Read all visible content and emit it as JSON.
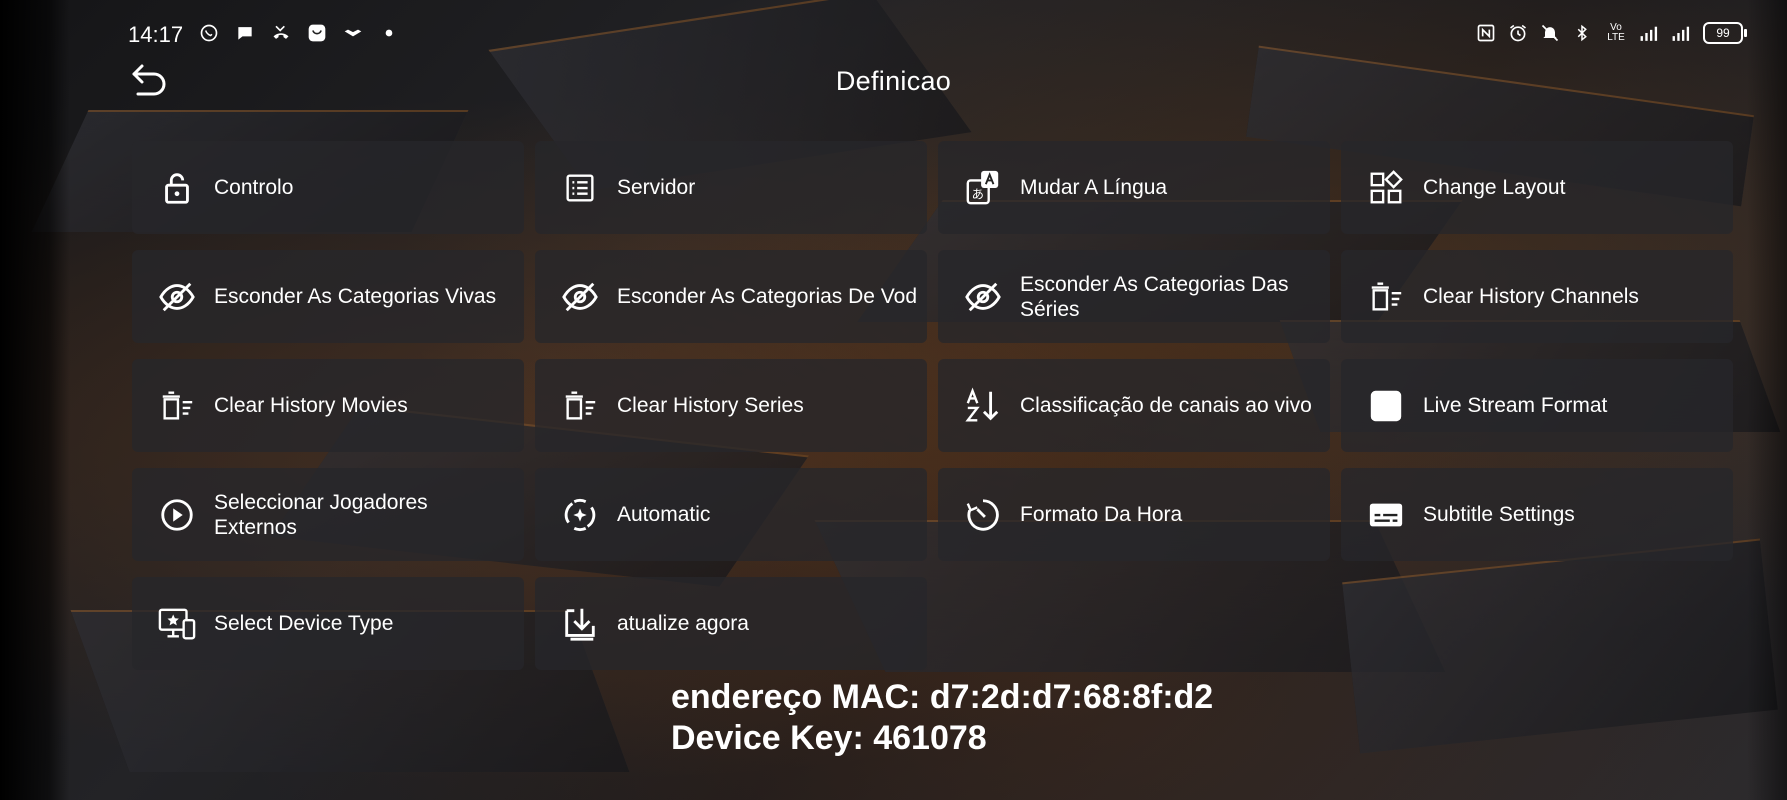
{
  "status_bar": {
    "time": "14:17",
    "battery": "99",
    "left_icons": [
      "whatsapp-icon",
      "chat-icon",
      "missed-call-icon",
      "app-icon",
      "bird-icon",
      "dot-icon"
    ],
    "right_icons": [
      "nfc-icon",
      "alarm-icon",
      "mute-icon",
      "bluetooth-icon",
      "volte-icon",
      "signal-4g-icon",
      "signal-icon"
    ]
  },
  "header": {
    "title": "Definicao"
  },
  "tiles": [
    {
      "label": "Controlo",
      "icon": "lock-icon"
    },
    {
      "label": "Servidor",
      "icon": "list-icon"
    },
    {
      "label": "Mudar A Língua",
      "icon": "translate-icon"
    },
    {
      "label": "Change Layout",
      "icon": "layout-icon"
    },
    {
      "label": "Esconder As Categorias Vivas",
      "icon": "eye-off-icon"
    },
    {
      "label": "Esconder As Categorias De Vod",
      "icon": "eye-off-icon"
    },
    {
      "label": "Esconder As Categorias Das Séries",
      "icon": "eye-off-icon"
    },
    {
      "label": "Clear History Channels",
      "icon": "delete-sweep-icon"
    },
    {
      "label": "Clear History Movies",
      "icon": "delete-sweep-icon"
    },
    {
      "label": "Clear History Series",
      "icon": "delete-sweep-icon"
    },
    {
      "label": "Classificação de canais ao vivo",
      "icon": "sort-az-icon"
    },
    {
      "label": "Live Stream Format",
      "icon": "square-icon"
    },
    {
      "label": "Seleccionar Jogadores Externos",
      "icon": "play-circle-icon"
    },
    {
      "label": "Automatic",
      "icon": "auto-icon"
    },
    {
      "label": "Formato Da Hora",
      "icon": "clock-icon"
    },
    {
      "label": "Subtitle Settings",
      "icon": "subtitles-icon"
    },
    {
      "label": "Select Device Type",
      "icon": "device-icon"
    },
    {
      "label": "atualize agora",
      "icon": "download-icon"
    }
  ],
  "info": {
    "mac": "endereço MAC: d7:2d:d7:68:8f:d2",
    "device_key": "Device Key: 461078"
  }
}
